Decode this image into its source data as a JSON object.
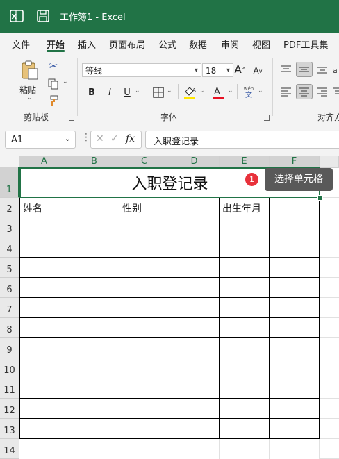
{
  "titlebar": {
    "title": "工作簿1  -  Excel"
  },
  "menu": {
    "tabs": [
      "文件",
      "开始",
      "插入",
      "页面布局",
      "公式",
      "数据",
      "审阅",
      "视图",
      "PDF工具集"
    ],
    "active": "开始"
  },
  "ribbon": {
    "clipboard": {
      "paste_label": "粘贴",
      "group_label": "剪贴板"
    },
    "font": {
      "font_name": "等线",
      "font_size": "18",
      "grow_label": "A",
      "shrink_label": "A",
      "bold_label": "B",
      "italic_label": "I",
      "underline_label": "U",
      "fill_letter": "A",
      "font_color_letter": "A",
      "phonetic_top": "wén",
      "phonetic_bottom": "文",
      "group_label": "字体"
    },
    "alignment": {
      "group_label": "对齐方"
    }
  },
  "formula_bar": {
    "name_box": "A1",
    "fx": "fx",
    "value": "入职登记录"
  },
  "grid": {
    "columns": [
      "A",
      "B",
      "C",
      "D",
      "E",
      "F"
    ],
    "rows": [
      "1",
      "2",
      "3",
      "4",
      "5",
      "6",
      "7",
      "8",
      "9",
      "10",
      "11",
      "12",
      "13",
      "14"
    ],
    "title": "入职登记录",
    "row2": {
      "A": "姓名",
      "C": "性别",
      "E": "出生年月"
    }
  },
  "tooltip": {
    "step": "1",
    "text": "选择单元格"
  },
  "colors": {
    "accent": "#217346",
    "badge": "#e8313b",
    "tooltip_bg": "#595959"
  }
}
